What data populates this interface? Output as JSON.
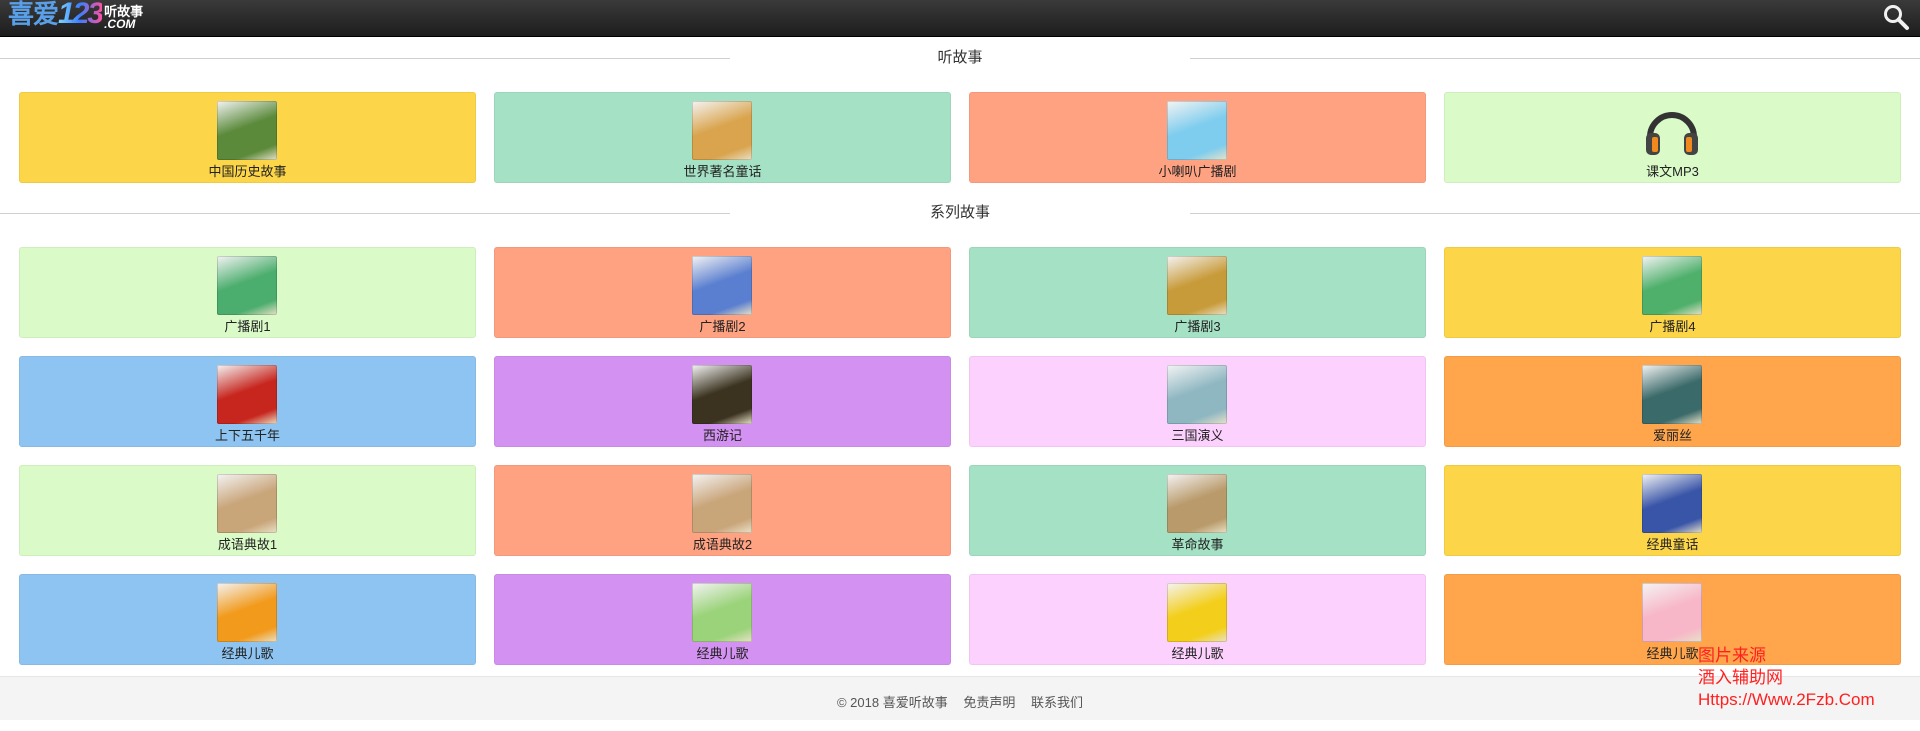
{
  "header": {
    "logo_cn": "喜爱",
    "logo_num": "123",
    "logo_sub_top": "听故事",
    "logo_sub_bottom": ".COM"
  },
  "sections": [
    {
      "title": "听故事",
      "cards": [
        {
          "label": "中国历史故事",
          "bg": "#fcd548",
          "thumb": "#5a8a3a"
        },
        {
          "label": "世界著名童话",
          "bg": "#a5e1c4",
          "thumb": "#d9a44d"
        },
        {
          "label": "小喇叭广播剧",
          "bg": "#ffa282",
          "thumb": "#7fcdee"
        },
        {
          "label": "课文MP3",
          "bg": "#dafbc8",
          "thumb": "none"
        }
      ]
    },
    {
      "title": "系列故事",
      "cards": [
        {
          "label": "广播剧1",
          "bg": "#dafbc8",
          "thumb": "#4cae6e"
        },
        {
          "label": "广播剧2",
          "bg": "#ffa282",
          "thumb": "#5a7fd0"
        },
        {
          "label": "广播剧3",
          "bg": "#a5e1c4",
          "thumb": "#c89b3a"
        },
        {
          "label": "广播剧4",
          "bg": "#fcd548",
          "thumb": "#4fb06c"
        },
        {
          "label": "上下五千年",
          "bg": "#8ec4f1",
          "thumb": "#c7261e"
        },
        {
          "label": "西游记",
          "bg": "#d392f1",
          "thumb": "#3b3320"
        },
        {
          "label": "三国演义",
          "bg": "#fcd1fe",
          "thumb": "#8fb7c2"
        },
        {
          "label": "爱丽丝",
          "bg": "#ffa54c",
          "thumb": "#3b6a6a"
        },
        {
          "label": "成语典故1",
          "bg": "#dafbc8",
          "thumb": "#c9a57a"
        },
        {
          "label": "成语典故2",
          "bg": "#ffa282",
          "thumb": "#c9a57a"
        },
        {
          "label": "革命故事",
          "bg": "#a5e1c4",
          "thumb": "#b99a6a"
        },
        {
          "label": "经典童话",
          "bg": "#fcd548",
          "thumb": "#3955a8"
        },
        {
          "label": "经典儿歌",
          "bg": "#8ec4f1",
          "thumb": "#f29a1c"
        },
        {
          "label": "经典儿歌",
          "bg": "#d392f1",
          "thumb": "#9bd37a"
        },
        {
          "label": "经典儿歌",
          "bg": "#fcd1fe",
          "thumb": "#f3cf1c"
        },
        {
          "label": "经典儿歌",
          "bg": "#ffa54c",
          "thumb": "#f7b7c8"
        }
      ]
    }
  ],
  "footer": {
    "copyright": "© 2018 喜爱听故事",
    "disclaimer": "免责声明",
    "contact": "联系我们"
  },
  "watermark": {
    "line1": "图片来源",
    "line2": "酒入辅助网",
    "line3": "Https://Www.2Fzb.Com"
  }
}
